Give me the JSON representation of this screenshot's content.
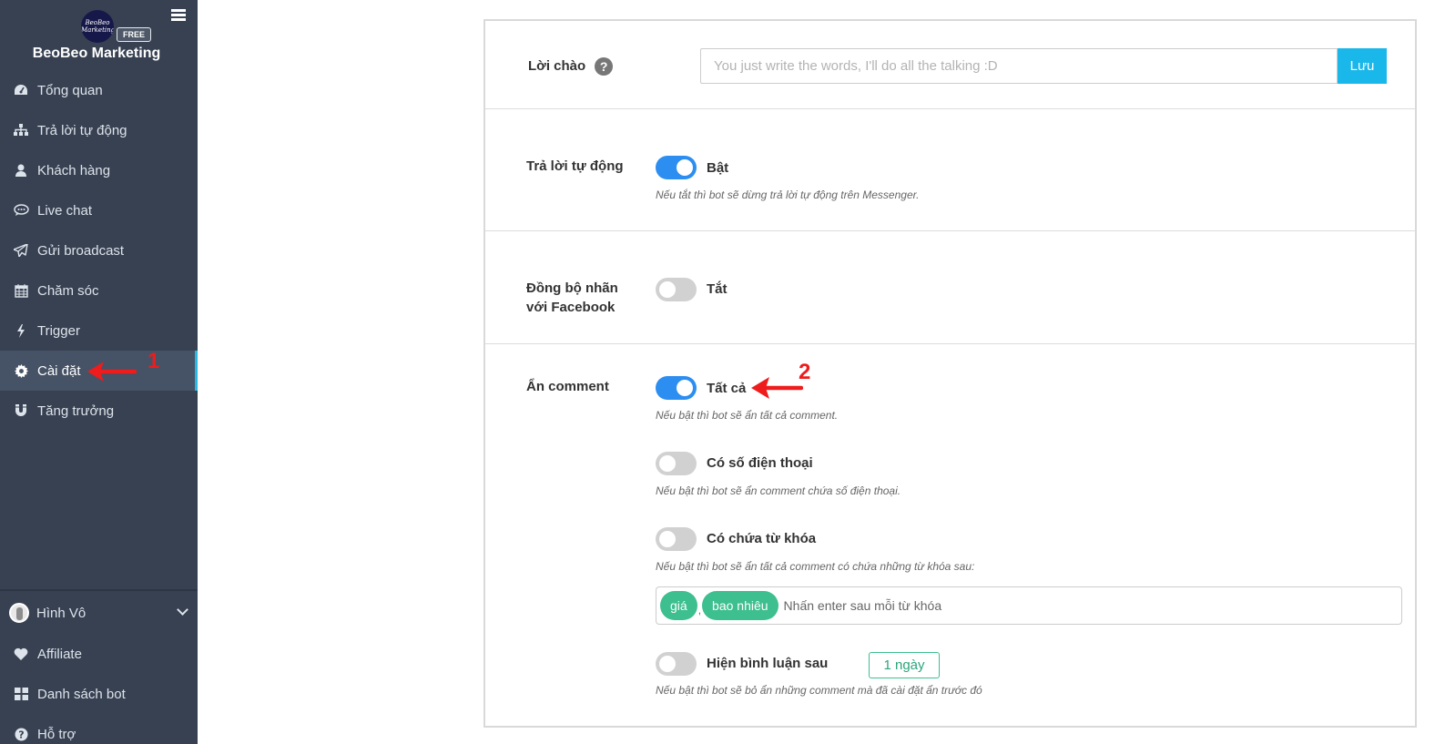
{
  "brand": {
    "logo_text": "BeoBeo Marketing",
    "badge": "FREE",
    "name": "BeoBeo Marketing"
  },
  "sidebar": {
    "items": [
      {
        "label": "Tổng quan",
        "icon": "dashboard-icon"
      },
      {
        "label": "Trả lời tự động",
        "icon": "sitemap-icon"
      },
      {
        "label": "Khách hàng",
        "icon": "user-icon"
      },
      {
        "label": "Live chat",
        "icon": "chat-bubble-icon"
      },
      {
        "label": "Gửi broadcast",
        "icon": "paper-plane-icon"
      },
      {
        "label": "Chăm sóc",
        "icon": "calendar-icon"
      },
      {
        "label": "Trigger",
        "icon": "bolt-icon"
      },
      {
        "label": "Cài đặt",
        "icon": "gear-icon",
        "active": true
      },
      {
        "label": "Tăng trưởng",
        "icon": "magnet-icon"
      }
    ],
    "bottom_items": [
      {
        "label": "Hình Vô",
        "icon": "avatar"
      },
      {
        "label": "Affiliate",
        "icon": "heart-icon"
      },
      {
        "label": "Danh sách bot",
        "icon": "grid-icon"
      },
      {
        "label": "Hỗ trợ",
        "icon": "help-icon"
      }
    ]
  },
  "annotations": {
    "one": "1",
    "two": "2",
    "color": "#ee1c1c"
  },
  "settings": {
    "greeting": {
      "label": "Lời chào",
      "placeholder": "You just write the words, I'll do all the talking :D",
      "save_label": "Lưu"
    },
    "auto_reply": {
      "label": "Trả lời tự động",
      "state": "Bật",
      "enabled": true,
      "hint": "Nếu tắt thì bot sẽ dừng trả lời tự động trên Messenger."
    },
    "sync_labels": {
      "label_line1": "Đồng bộ nhãn",
      "label_line2": "với Facebook",
      "state": "Tắt",
      "enabled": false
    },
    "hide_comment": {
      "label": "Ẩn comment",
      "options": [
        {
          "label": "Tất cả",
          "enabled": true,
          "hint": "Nếu bật thì bot sẽ ẩn tất cả comment."
        },
        {
          "label": "Có số điện thoại",
          "enabled": false,
          "hint": "Nếu bật thì bot sẽ ẩn comment chứa số điện thoại."
        },
        {
          "label": "Có chứa từ khóa",
          "enabled": false,
          "hint": "Nếu bật thì bot sẽ ẩn tất cả comment có chứa những từ khóa sau:"
        },
        {
          "label": "Hiện bình luận sau",
          "enabled": false,
          "hint": "Nếu bật thì bot sẽ bỏ ẩn những comment mà đã cài đặt ẩn trước đó"
        }
      ],
      "keywords": [
        "giá",
        "bao nhiêu"
      ],
      "keyword_separator": ",",
      "keyword_placeholder": "Nhấn enter sau mỗi từ khóa",
      "delay_value": "1 ngày"
    }
  },
  "colors": {
    "sidebar_bg": "#374152",
    "active_bg": "#465266",
    "accent": "#1ab7ea",
    "toggle_on": "#2c8ef0",
    "tag_green": "#3dbf8f"
  }
}
